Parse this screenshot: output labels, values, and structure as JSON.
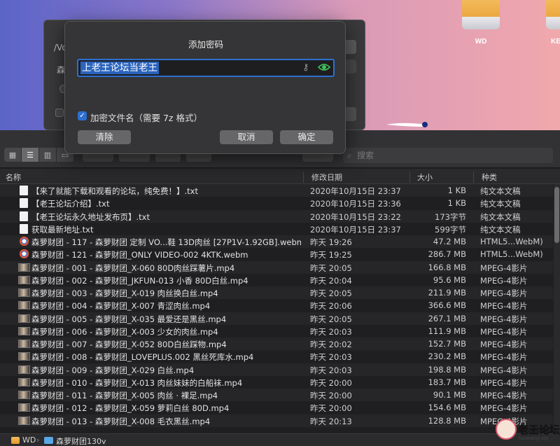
{
  "desktop": {
    "drives": [
      {
        "label": "WD"
      },
      {
        "label": "KE"
      }
    ]
  },
  "back_window": {
    "path": "/Vo",
    "name_prefix": "森"
  },
  "dialog": {
    "title": "添加密码",
    "password_value": "上老王论坛当老王",
    "encrypt_filenames_label": "加密文件名（需要 7z 格式）",
    "clear_label": "清除",
    "cancel_label": "取消",
    "ok_label": "确定"
  },
  "finder": {
    "search_placeholder": "搜索",
    "columns": {
      "name": "名称",
      "date": "修改日期",
      "size": "大小",
      "kind": "种类"
    },
    "files": [
      {
        "icon": "text-file-icon",
        "name": "【来了就能下载和观看的论坛，纯免费！】.txt",
        "date": "2020年10月15日 23:37",
        "size": "1 KB",
        "kind": "纯文本文稿"
      },
      {
        "icon": "text-file-icon",
        "name": "【老王论坛介绍】.txt",
        "date": "2020年10月15日 23:36",
        "size": "1 KB",
        "kind": "纯文本文稿"
      },
      {
        "icon": "text-file-icon",
        "name": "【老王论坛永久地址发布页】.txt",
        "date": "2020年10月15日 23:22",
        "size": "173字节",
        "kind": "纯文本文稿"
      },
      {
        "icon": "text-file-icon",
        "name": "获取最新地址.txt",
        "date": "2020年10月15日 23:37",
        "size": "599字节",
        "kind": "纯文本文稿"
      },
      {
        "icon": "webm-file-icon",
        "name": "森萝财团 - 117 - 森萝财团 定制 VO...鞋 13D肉丝 [27P1V-1.92GB].webm",
        "date": "昨天 19:26",
        "size": "47.2 MB",
        "kind": "HTML5...WebM)"
      },
      {
        "icon": "webm-file-icon",
        "name": "森萝财团 - 121 - 森萝财团_ONLY VIDEO-002 4KTK.webm",
        "date": "昨天 19:25",
        "size": "286.7 MB",
        "kind": "HTML5...WebM)"
      },
      {
        "icon": "video-file-icon",
        "name": "森萝财团 - 001 - 森萝财团_X-060 80D肉丝踩薯片.mp4",
        "date": "昨天 20:05",
        "size": "166.8 MB",
        "kind": "MPEG-4影片"
      },
      {
        "icon": "video-file-icon",
        "name": "森萝财团 - 002 - 森萝财团_JKFUN-013 小香 80D白丝.mp4",
        "date": "昨天 20:04",
        "size": "95.6 MB",
        "kind": "MPEG-4影片"
      },
      {
        "icon": "video-file-icon",
        "name": "森萝财团 - 003 - 森萝财团_X-019 肉丝换白丝.mp4",
        "date": "昨天 20:05",
        "size": "211.9 MB",
        "kind": "MPEG-4影片"
      },
      {
        "icon": "video-file-icon",
        "name": "森萝财团 - 004 - 森萝财团_X-007 青涩肉丝.mp4",
        "date": "昨天 20:06",
        "size": "366.6 MB",
        "kind": "MPEG-4影片"
      },
      {
        "icon": "video-file-icon",
        "name": "森萝财团 - 005 - 森萝财团_X-035 最爱还是黑丝.mp4",
        "date": "昨天 20:05",
        "size": "267.1 MB",
        "kind": "MPEG-4影片"
      },
      {
        "icon": "video-file-icon",
        "name": "森萝财团 - 006 - 森萝财团_X-003 少女的肉丝.mp4",
        "date": "昨天 20:03",
        "size": "111.9 MB",
        "kind": "MPEG-4影片"
      },
      {
        "icon": "video-file-icon",
        "name": "森萝财团 - 007 - 森萝财团_X-052 80D白丝踩物.mp4",
        "date": "昨天 20:02",
        "size": "152.7 MB",
        "kind": "MPEG-4影片"
      },
      {
        "icon": "video-file-icon",
        "name": "森萝财团 - 008 - 森萝财团_LOVEPLUS.002 黑丝死库水.mp4",
        "date": "昨天 20:03",
        "size": "230.2 MB",
        "kind": "MPEG-4影片"
      },
      {
        "icon": "video-file-icon",
        "name": "森萝财团 - 009 - 森萝财团_X-029 白丝.mp4",
        "date": "昨天 20:03",
        "size": "198.8 MB",
        "kind": "MPEG-4影片"
      },
      {
        "icon": "video-file-icon",
        "name": "森萝财团 - 010 - 森萝财团_X-013 肉丝妹妹的白船袜.mp4",
        "date": "昨天 20:00",
        "size": "183.7 MB",
        "kind": "MPEG-4影片"
      },
      {
        "icon": "video-file-icon",
        "name": "森萝财团 - 011 - 森萝财团_X-005 肉丝 · 裸足.mp4",
        "date": "昨天 20:00",
        "size": "90.1 MB",
        "kind": "MPEG-4影片"
      },
      {
        "icon": "video-file-icon",
        "name": "森萝财团 - 012 - 森萝财团_X-059 萝莉白丝 80D.mp4",
        "date": "昨天 20:00",
        "size": "154.6 MB",
        "kind": "MPEG-4影片"
      },
      {
        "icon": "video-file-icon",
        "name": "森萝财团 - 013 - 森萝财团_X-008 毛衣黑丝.mp4",
        "date": "昨天 20:13",
        "size": "128.8 MB",
        "kind": "MPEG-4影片"
      }
    ],
    "pathbar": {
      "drive": "WD",
      "folder": "森萝财团130v"
    }
  },
  "watermark": {
    "text": "老王论坛",
    "sub": "laowang.vip"
  }
}
